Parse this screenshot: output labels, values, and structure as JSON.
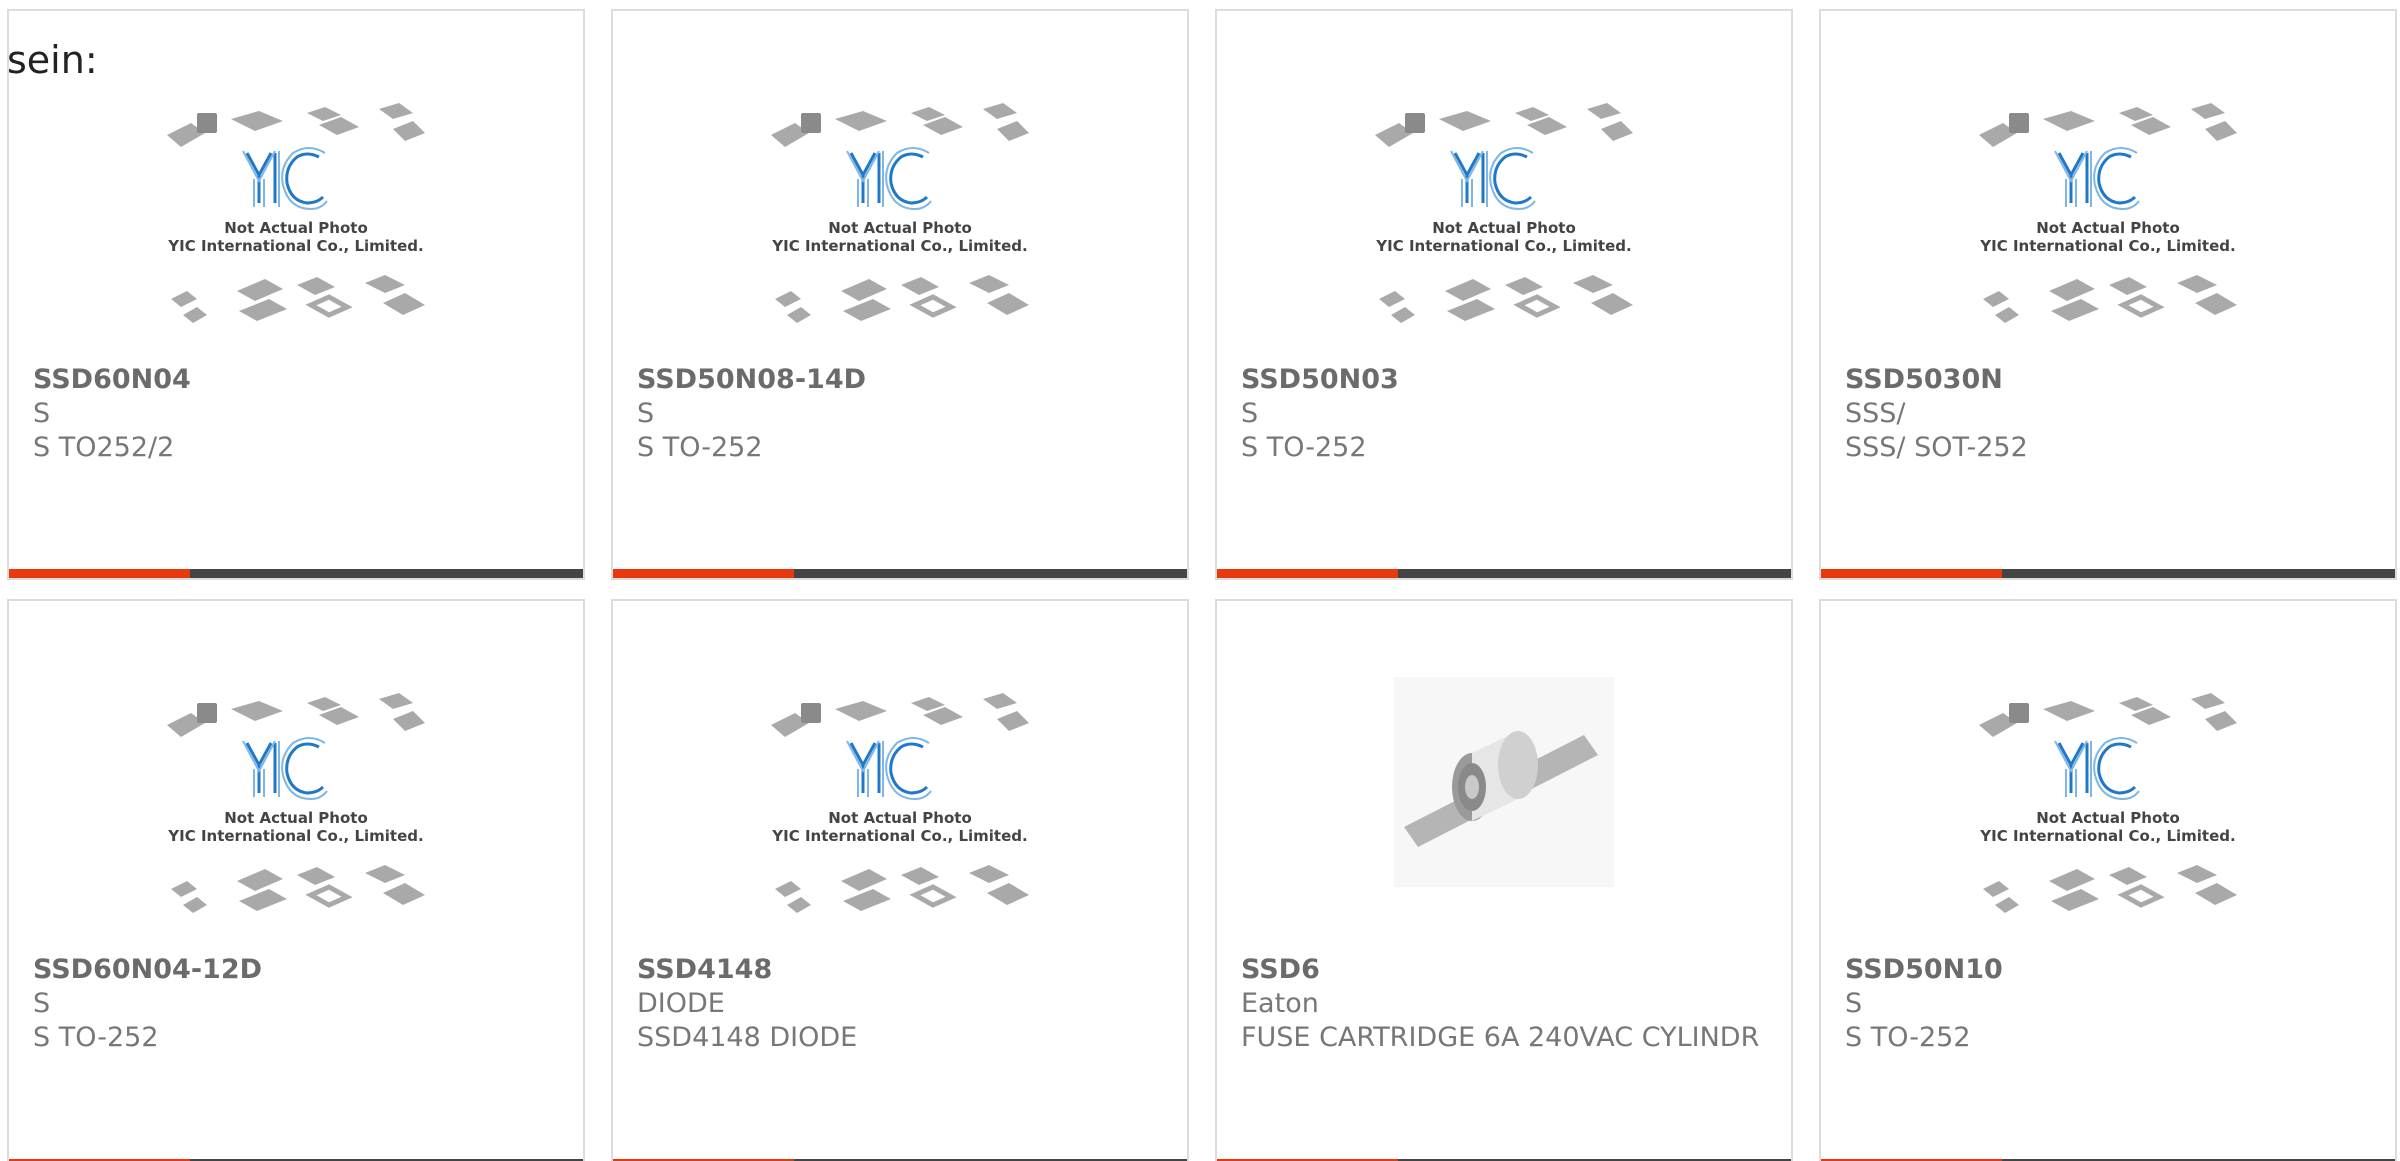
{
  "intro_text": "sein:",
  "watermark": {
    "line1": "Not Actual Photo",
    "line2": "YIC International Co., Limited.",
    "logo_text": "YIC"
  },
  "colors": {
    "accent": "#e8380d",
    "bar": "#444444",
    "logo_blue": "#1f78c8"
  },
  "products": [
    {
      "part": "SSD60N04",
      "maker": "S",
      "desc": "S TO252/2",
      "image": "placeholder-chips"
    },
    {
      "part": "SSD50N08-14D",
      "maker": "S",
      "desc": "S TO-252",
      "image": "placeholder-chips"
    },
    {
      "part": "SSD50N03",
      "maker": "S",
      "desc": "S TO-252",
      "image": "placeholder-chips"
    },
    {
      "part": "SSD5030N",
      "maker": "SSS/",
      "desc": "SSS/ SOT-252",
      "image": "placeholder-chips"
    },
    {
      "part": "SSD60N04-12D",
      "maker": "S",
      "desc": "S TO-252",
      "image": "placeholder-chips"
    },
    {
      "part": "SSD4148",
      "maker": "DIODE",
      "desc": "SSD4148 DIODE",
      "image": "placeholder-chips"
    },
    {
      "part": "SSD6",
      "maker": "Eaton",
      "desc": "FUSE CARTRIDGE 6A 240VAC CYLINDR",
      "image": "fuse-photo"
    },
    {
      "part": "SSD50N10",
      "maker": "S",
      "desc": "S TO-252",
      "image": "placeholder-chips"
    }
  ]
}
